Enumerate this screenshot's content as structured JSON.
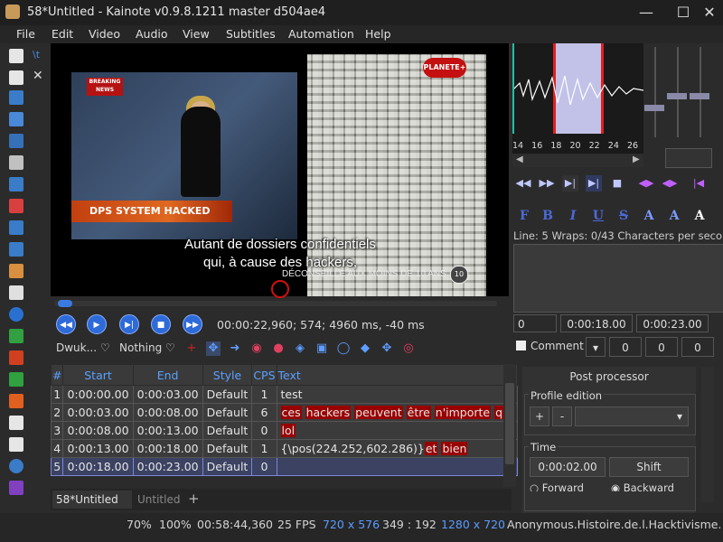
{
  "window": {
    "title": "58*Untitled - Kainote v0.9.8.1211  master d504ae4",
    "min": "—",
    "max": "☐",
    "close": "✕"
  },
  "menu": [
    "File",
    "Edit",
    "Video",
    "Audio",
    "View",
    "Subtitles",
    "Automation",
    "Help"
  ],
  "video": {
    "breaking": "BREAKING NEWS",
    "banner": "DPS SYSTEM HACKED",
    "channel_logo": "PLANETE+",
    "subtitle_line1": "Autant de dossiers confidentiels",
    "subtitle_line2": "qui, à cause des hackers,",
    "rating_text": "DÉCONSEILLÉ AUX MOINS DE 10 ANS",
    "rating_badge": "10",
    "time_info": "00:00:22,960;  574;  4960 ms, -40 ms",
    "seek_progress": 0.01
  },
  "video_toolbar": {
    "combo1": "Dwuk...",
    "combo2": "Nothing"
  },
  "grid": {
    "columns": [
      "#",
      "Start",
      "End",
      "Style",
      "CPS",
      "Text"
    ],
    "rows": [
      {
        "n": "1",
        "start": "0:00:00.00",
        "end": "0:00:03.00",
        "style": "Default",
        "cps": "1",
        "text": "test",
        "parts": []
      },
      {
        "n": "2",
        "start": "0:00:03.00",
        "end": "0:00:08.00",
        "style": "Default",
        "cps": "6",
        "text": "",
        "parts": [
          "ces",
          "hackers",
          "peuvent",
          "être",
          "n'importe",
          "qui"
        ]
      },
      {
        "n": "3",
        "start": "0:00:08.00",
        "end": "0:00:13.00",
        "style": "Default",
        "cps": "0",
        "text": "",
        "parts": [
          "lol"
        ]
      },
      {
        "n": "4",
        "start": "0:00:13.00",
        "end": "0:00:18.00",
        "style": "Default",
        "cps": "1",
        "text": "{\\pos(224.252,602.286)}",
        "parts": [
          "et",
          "bien"
        ]
      },
      {
        "n": "5",
        "start": "0:00:18.00",
        "end": "0:00:23.00",
        "style": "Default",
        "cps": "0",
        "text": "",
        "parts": []
      }
    ],
    "selected_row": "5"
  },
  "tabs": [
    {
      "label": "58*Untitled",
      "close": "X"
    },
    {
      "label": "Untitled"
    }
  ],
  "tab_add": "+",
  "status": {
    "zoom1": "70%",
    "zoom2": "100%",
    "duration": "00:58:44,360",
    "fps": "25 FPS",
    "resolution": "720 x 576",
    "coords": "349 : 192",
    "script_res": "1280 x 720",
    "file": "Anonymous.Histoire.de.l.Hacktivisme.2"
  },
  "audio": {
    "ticks": [
      "14",
      "16",
      "18",
      "20",
      "22",
      "24",
      "26",
      "28"
    ]
  },
  "format_buttons": [
    "F",
    "B",
    "I",
    "U",
    "S",
    "A",
    "A",
    "A"
  ],
  "edit": {
    "line_info": "Line: 5  Wraps: 0/43  Characters per seco",
    "layer": "0",
    "start": "0:00:18.00",
    "end": "0:00:23.00",
    "comment_label": "Comment",
    "margin_l": "0",
    "margin_r": "0",
    "margin_v": "0"
  },
  "post_processor": {
    "title": "Post processor",
    "profile_label": "Profile edition",
    "add": "+",
    "remove": "-",
    "time_label": "Time",
    "time_value": "0:00:02.00",
    "shift": "Shift",
    "forward": "Forward",
    "backward": "Backward"
  }
}
